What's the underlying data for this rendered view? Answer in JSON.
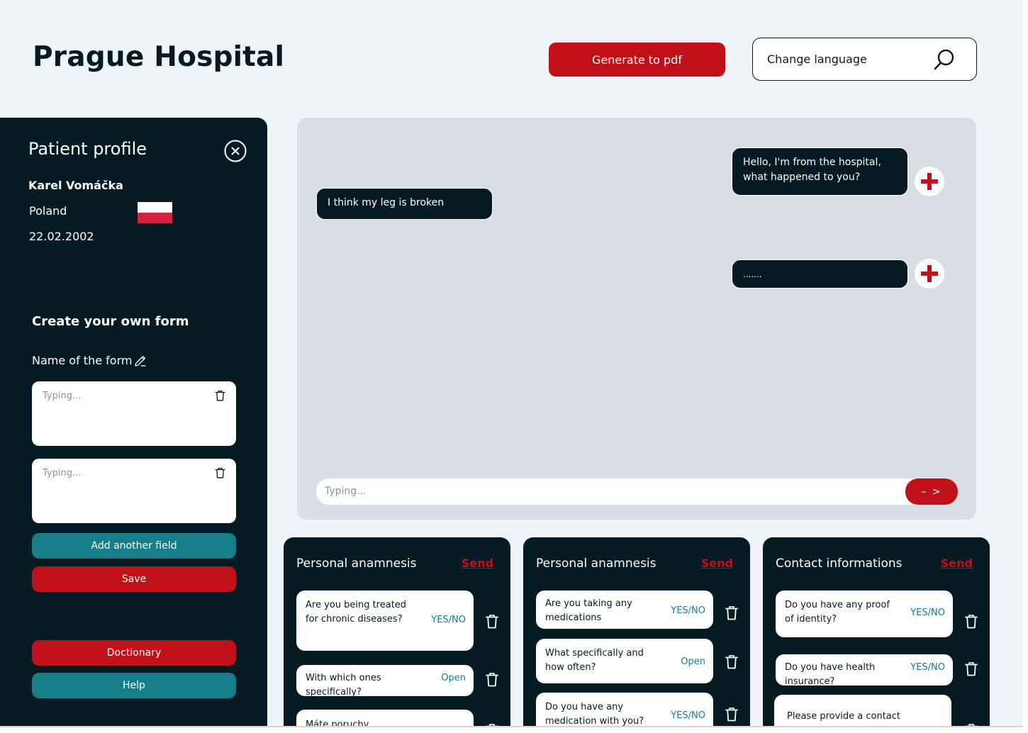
{
  "header": {
    "title": "Prague Hospital",
    "pdf_button": "Generate to pdf",
    "language_label": "Change language"
  },
  "sidebar": {
    "title": "Patient profile",
    "patient_name": "Karel Vomáčka",
    "country": "Poland",
    "birth_date": "22.02.2002",
    "form_title": "Create your own form",
    "form_name_label": "Name of the form",
    "field_placeholder": "Typing...",
    "add_field_button": "Add another field",
    "save_button": "Save",
    "dictionary_button": "Doctionary",
    "help_button": "Help",
    "flag_colors": {
      "top": "#ffffff",
      "bottom": "#d4213d"
    }
  },
  "chat": {
    "messages": [
      {
        "side": "right",
        "text": "Hello, I'm from the hospital, what happened to you?"
      },
      {
        "side": "left",
        "text": "I think my leg is broken"
      },
      {
        "side": "right",
        "text": "......."
      }
    ],
    "input_placeholder": "Typing...",
    "send_label": "– >"
  },
  "cards": [
    {
      "title": "Personal anamnesis",
      "send": "Send",
      "questions": [
        {
          "text": "Are you being treated for chronic diseases?",
          "answer": "YES/NO"
        },
        {
          "text": "With which ones specifically?",
          "answer": "Open"
        },
        {
          "text": "Máte poruchy",
          "answer": ""
        }
      ]
    },
    {
      "title": "Personal anamnesis",
      "send": "Send",
      "questions": [
        {
          "text": "Are you taking any medications",
          "answer": "YES/NO"
        },
        {
          "text": "What specifically and how often?",
          "answer": "Open"
        },
        {
          "text": "Do you have any medication with you?",
          "answer": "YES/NO"
        }
      ]
    },
    {
      "title": "Contact informations",
      "send": "Send",
      "questions": [
        {
          "text": "Do you have any proof of identity?",
          "answer": "YES/NO"
        },
        {
          "text": "Do you have health insurance?",
          "answer": "YES/NO"
        },
        {
          "text": "Please provide a contact",
          "answer": ""
        }
      ]
    }
  ],
  "colors": {
    "primary_dark": "#061a24",
    "accent_red": "#c0111a",
    "accent_teal": "#157e88",
    "page_bg": "#eff4f8",
    "chat_bg": "#d8dee4"
  }
}
